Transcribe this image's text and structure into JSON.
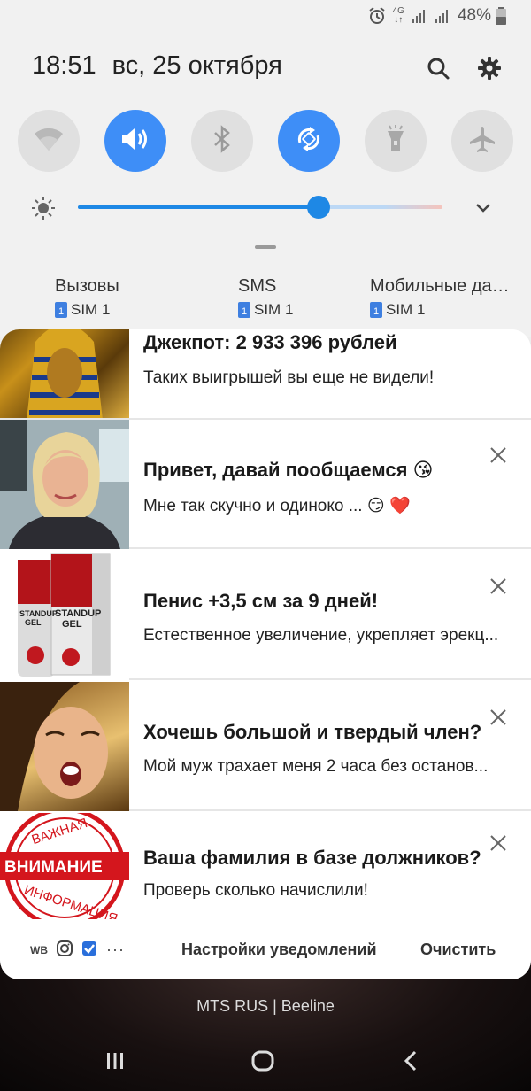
{
  "status_bar": {
    "network": "4G",
    "battery": "48%",
    "icons": [
      "alarm-icon",
      "network-4g-icon",
      "signal-sim1-icon",
      "signal-sim2-icon",
      "battery-icon"
    ]
  },
  "header": {
    "time": "18:51",
    "date": "вс, 25 октября",
    "icons": [
      "search-icon",
      "gear-icon"
    ]
  },
  "quick_toggles": [
    {
      "name": "wifi",
      "icon": "wifi-icon",
      "on": false
    },
    {
      "name": "sound",
      "icon": "sound-icon",
      "on": true
    },
    {
      "name": "bluetooth",
      "icon": "bluetooth-icon",
      "on": false
    },
    {
      "name": "auto-rotate",
      "icon": "rotate-icon",
      "on": true
    },
    {
      "name": "flashlight",
      "icon": "flashlight-icon",
      "on": false
    },
    {
      "name": "airplane",
      "icon": "airplane-icon",
      "on": false
    }
  ],
  "brightness": {
    "level": 0.66,
    "accent": "#1e88e5"
  },
  "data_usage": [
    {
      "label": "Вызовы",
      "sim": "SIM 1"
    },
    {
      "label": "SMS",
      "sim": "SIM 1"
    },
    {
      "label": "Мобильные да…",
      "sim": "SIM 1"
    }
  ],
  "notifications": [
    {
      "title": "Джекпот: 2 933 396 рублей",
      "text": "Таких выигрышей вы еще не видели!",
      "image": "pharaoh-image",
      "closable": false
    },
    {
      "title": "Привет, давай пообщаемся 😘",
      "text": "Мне так скучно и одиноко ... 😏 ❤️",
      "image": "woman-portrait-image",
      "closable": true
    },
    {
      "title": "Пенис +3,5 см за 9 дней!",
      "text": "Естественное увеличение, укрепляет эрекц...",
      "image": "gel-product-image",
      "closable": true
    },
    {
      "title": "Хочешь большой и твердый член?",
      "text": "Мой муж трахает меня 2 часа без останов...",
      "image": "woman-face-image",
      "closable": true
    },
    {
      "title": "Ваша фамилия в базе должников?",
      "text": "Проверь сколько начислили!",
      "image": "stamp-image",
      "closable": true
    }
  ],
  "stamp": {
    "top": "ВАЖНАЯ",
    "middle": "ВНИМАНИЕ",
    "bottom": "ИНФОРМАЦИЯ"
  },
  "gel_brand": {
    "line1": "STANDUP",
    "line2": "GEL"
  },
  "footer": {
    "app_icons": [
      "wb-icon",
      "instagram-icon",
      "checkbox-app-icon",
      "more-icon"
    ],
    "wb_label": "WB",
    "settings_label": "Настройки уведомлений",
    "clear_label": "Очистить"
  },
  "carrier": "MTS RUS | Beeline",
  "nav_bar": [
    "recents-icon",
    "home-icon",
    "back-icon"
  ]
}
